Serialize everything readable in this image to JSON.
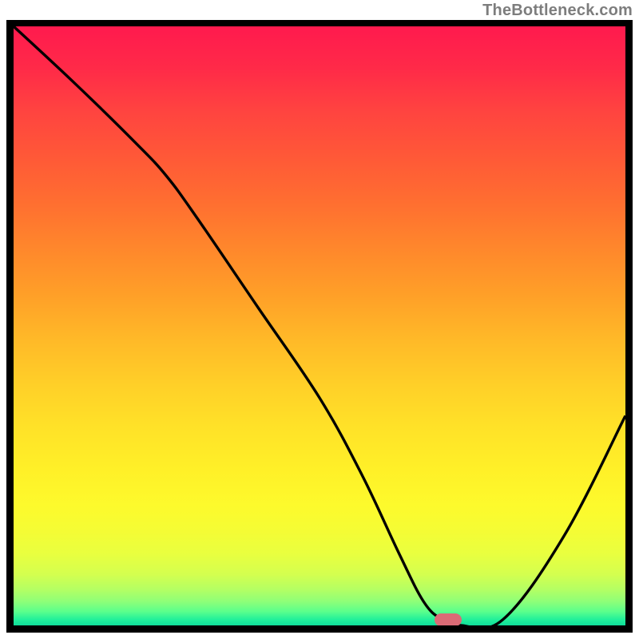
{
  "watermark": "TheBottleneck.com",
  "colors": {
    "frame": "#000000",
    "curve": "#000000",
    "marker": "#db6b76"
  },
  "chart_data": {
    "type": "line",
    "title": "",
    "xlabel": "",
    "ylabel": "",
    "xlim": [
      0,
      100
    ],
    "ylim": [
      0,
      100
    ],
    "grid": false,
    "series": [
      {
        "name": "bottleneck-curve",
        "x": [
          0,
          10,
          20,
          25,
          30,
          40,
          50,
          57,
          63,
          67,
          70,
          73,
          80,
          90,
          100
        ],
        "values": [
          100,
          90.5,
          80.5,
          75,
          68,
          53,
          38,
          25,
          12,
          4,
          1,
          0,
          1,
          15,
          35
        ]
      }
    ],
    "annotations": [
      {
        "name": "optimum-marker",
        "x": 71,
        "y": 1
      }
    ]
  }
}
